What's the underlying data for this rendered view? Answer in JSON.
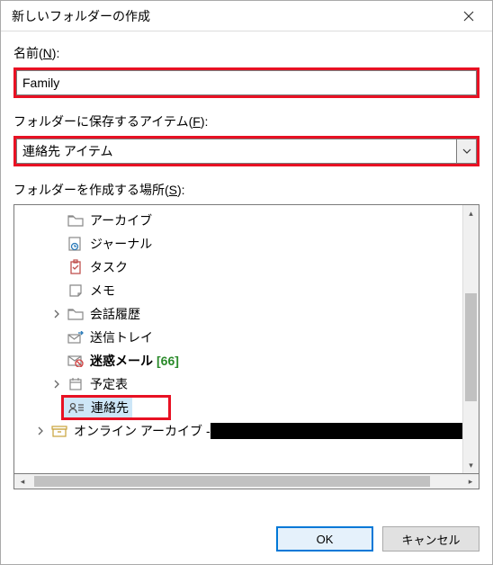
{
  "dialog": {
    "title": "新しいフォルダーの作成",
    "name_label_pre": "名前(",
    "name_label_u": "N",
    "name_label_post": "):",
    "name_value": "Family",
    "type_label_pre": "フォルダーに保存するアイテム(",
    "type_label_u": "F",
    "type_label_post": "):",
    "type_value": "連絡先 アイテム",
    "location_label_pre": "フォルダーを作成する場所(",
    "location_label_u": "S",
    "location_label_post": "):",
    "ok_label": "OK",
    "cancel_label": "キャンセル"
  },
  "tree": {
    "items": [
      {
        "label": "アーカイブ",
        "icon": "folder"
      },
      {
        "label": "ジャーナル",
        "icon": "journal"
      },
      {
        "label": "タスク",
        "icon": "task"
      },
      {
        "label": "メモ",
        "icon": "note"
      },
      {
        "label": "会話履歴",
        "icon": "folder",
        "expandable": true
      },
      {
        "label": "送信トレイ",
        "icon": "outbox"
      },
      {
        "label": "迷惑メール",
        "icon": "junk",
        "bold": true,
        "count": "[66]"
      },
      {
        "label": "予定表",
        "icon": "calendar",
        "expandable": true
      },
      {
        "label": "連絡先",
        "icon": "contacts",
        "selected": true
      },
      {
        "label": "オンライン アーカイブ -",
        "icon": "archive",
        "expandable": true,
        "redacted": true
      }
    ]
  }
}
